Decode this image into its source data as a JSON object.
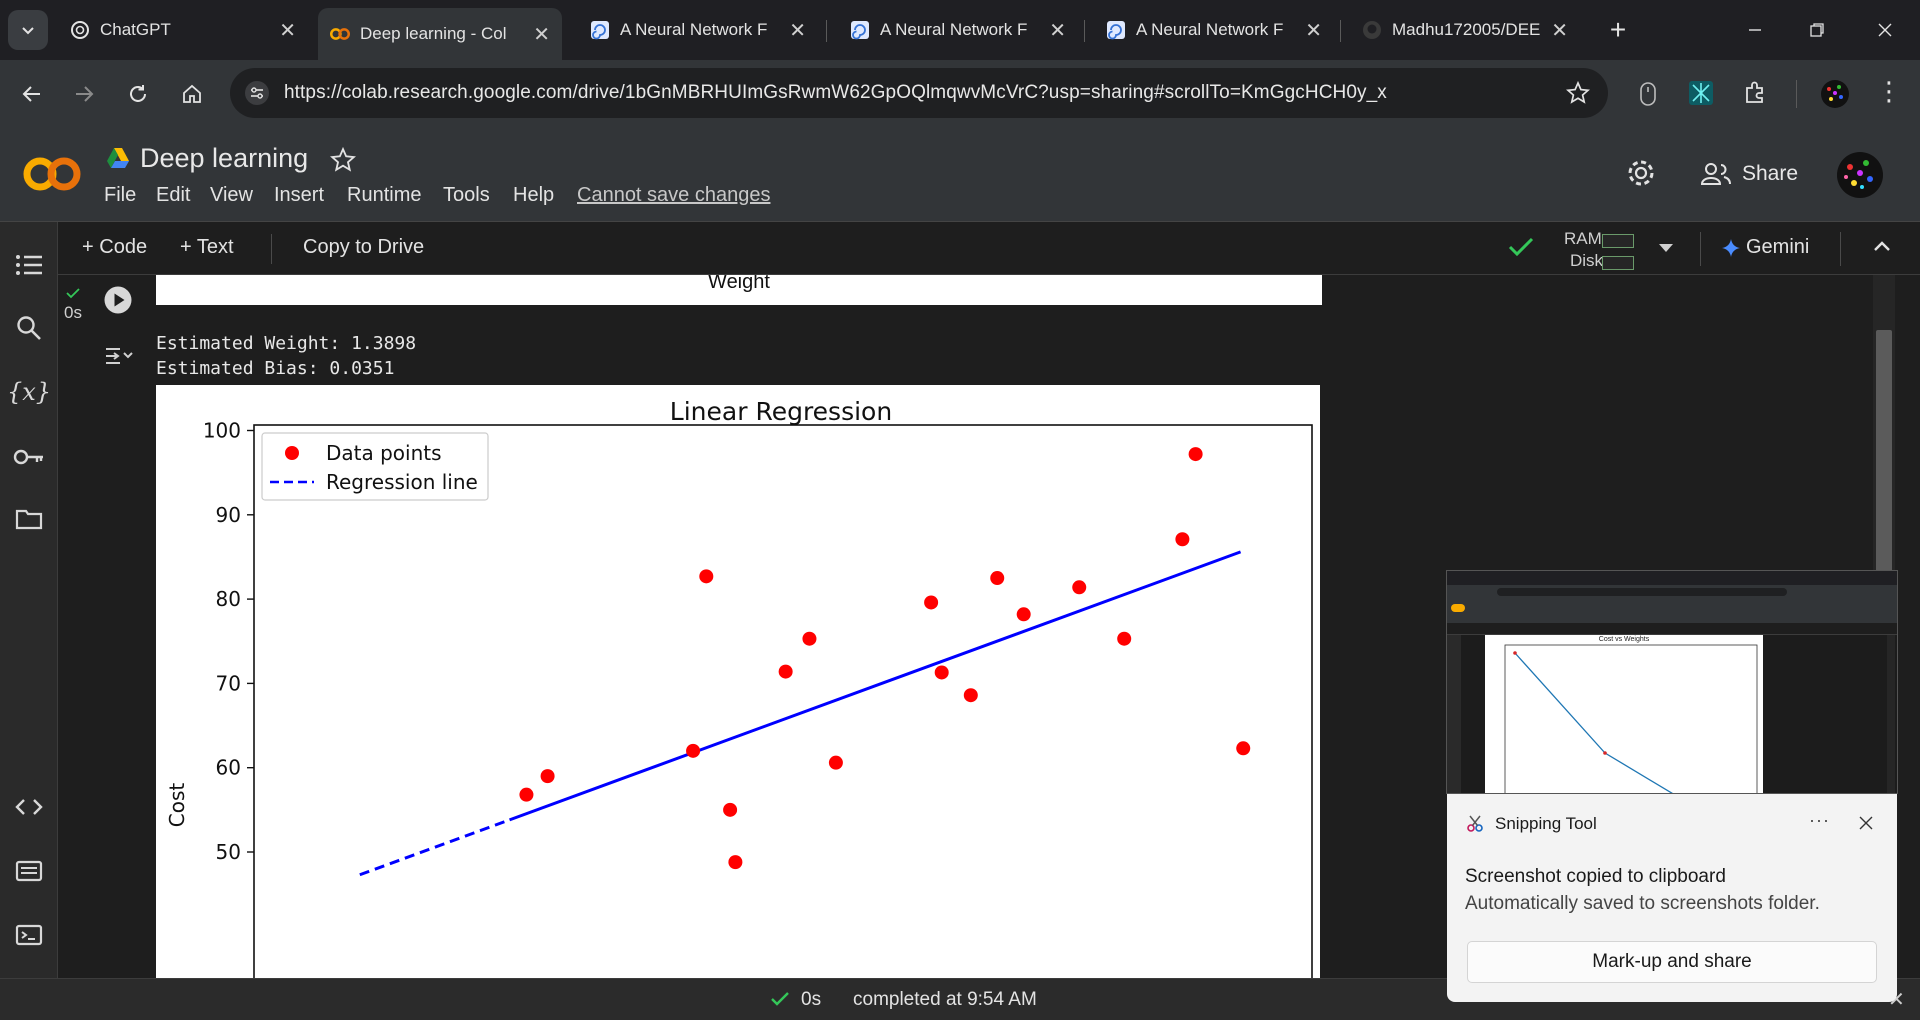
{
  "browser": {
    "tabs": [
      {
        "label": "ChatGPT",
        "icon": "chatgpt-icon",
        "active": false
      },
      {
        "label": "Deep learning - Col",
        "icon": "colab-icon",
        "active": true
      },
      {
        "label": "A Neural Network F",
        "icon": "spiral-icon",
        "active": false
      },
      {
        "label": "A Neural Network F",
        "icon": "spiral-icon",
        "active": false
      },
      {
        "label": "A Neural Network F",
        "icon": "spiral-icon",
        "active": false
      },
      {
        "label": "Madhu172005/DEE",
        "icon": "github-icon",
        "active": false
      }
    ],
    "url": "https://colab.research.google.com/drive/1bGnMBRHUImGsRwmW62GpOQlmqwvMcVrC?usp=sharing#scrollTo=KmGgcHCH0y_x"
  },
  "colab": {
    "title": "Deep learning",
    "menu": [
      "File",
      "Edit",
      "View",
      "Insert",
      "Runtime",
      "Tools",
      "Help"
    ],
    "cannot_save": "Cannot save changes",
    "share_label": "Share",
    "toolbar": {
      "code_label": "Code",
      "text_label": "Text",
      "copy_label": "Copy to Drive",
      "ram_label": "RAM",
      "disk_label": "Disk",
      "gemini_label": "Gemini"
    }
  },
  "cell": {
    "exec_time": "0s",
    "prev_plot_xlabel": "Weight",
    "output_lines": [
      "Estimated Weight: 1.3898",
      "Estimated Bias: 0.0351"
    ]
  },
  "chart_data": {
    "type": "scatter",
    "title": "Linear Regression",
    "xlabel": "",
    "ylabel": "Cost",
    "ylim": [
      47,
      100.5
    ],
    "xlim": [
      30,
      70
    ],
    "yticks": [
      100,
      90,
      80,
      70,
      60,
      50
    ],
    "grid": false,
    "legend_placement": "top-left",
    "series": [
      {
        "name": "Data points",
        "kind": "scatter",
        "color": "#ff0000",
        "points": [
          [
            40.3,
            56.8
          ],
          [
            41.1,
            59.0
          ],
          [
            46.6,
            62.0
          ],
          [
            47.1,
            82.7
          ],
          [
            48.0,
            55.0
          ],
          [
            48.2,
            48.8
          ],
          [
            50.1,
            71.4
          ],
          [
            51.0,
            75.3
          ],
          [
            52.0,
            60.6
          ],
          [
            55.6,
            79.6
          ],
          [
            56.0,
            71.3
          ],
          [
            57.1,
            68.6
          ],
          [
            58.1,
            82.5
          ],
          [
            59.1,
            78.2
          ],
          [
            61.2,
            81.4
          ],
          [
            62.9,
            75.3
          ],
          [
            65.1,
            87.1
          ],
          [
            65.6,
            97.2
          ],
          [
            67.4,
            62.3
          ]
        ]
      },
      {
        "name": "Regression line",
        "kind": "line",
        "color": "#0000ff",
        "style": "dashed",
        "points": [
          [
            34.0,
            47.3
          ],
          [
            67.3,
            85.6
          ]
        ]
      }
    ]
  },
  "statusbar": {
    "elapsed": "0s",
    "completed": "completed at 9:54 AM"
  },
  "snipping": {
    "app_name": "Snipping Tool",
    "heading": "Screenshot copied to clipboard",
    "subtext": "Automatically saved to screenshots folder.",
    "button_label": "Mark-up and share",
    "more_label": "···",
    "thumb_chart_title": "Cost vs Weights"
  }
}
